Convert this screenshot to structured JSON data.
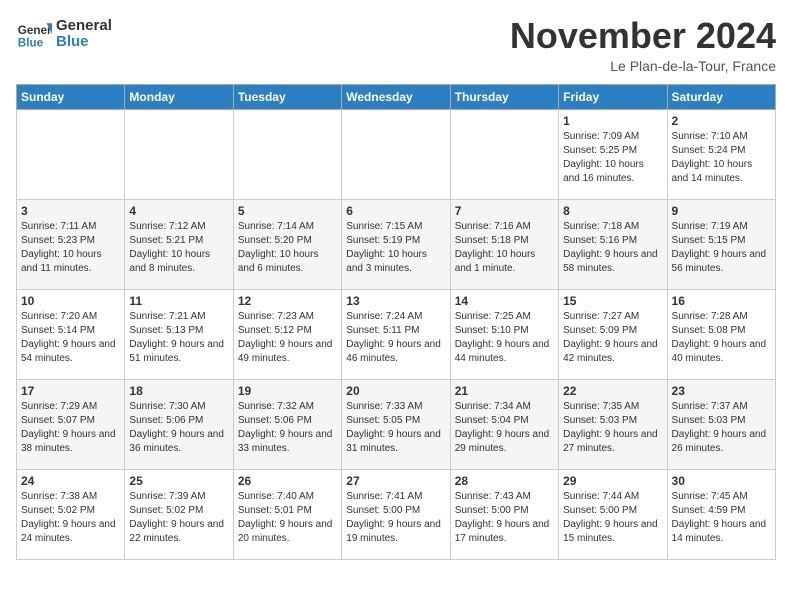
{
  "header": {
    "logo_line1": "General",
    "logo_line2": "Blue",
    "month": "November 2024",
    "location": "Le Plan-de-la-Tour, France"
  },
  "weekdays": [
    "Sunday",
    "Monday",
    "Tuesday",
    "Wednesday",
    "Thursday",
    "Friday",
    "Saturday"
  ],
  "weeks": [
    [
      {
        "day": "",
        "info": ""
      },
      {
        "day": "",
        "info": ""
      },
      {
        "day": "",
        "info": ""
      },
      {
        "day": "",
        "info": ""
      },
      {
        "day": "",
        "info": ""
      },
      {
        "day": "1",
        "info": "Sunrise: 7:09 AM\nSunset: 5:25 PM\nDaylight: 10 hours and 16 minutes."
      },
      {
        "day": "2",
        "info": "Sunrise: 7:10 AM\nSunset: 5:24 PM\nDaylight: 10 hours and 14 minutes."
      }
    ],
    [
      {
        "day": "3",
        "info": "Sunrise: 7:11 AM\nSunset: 5:23 PM\nDaylight: 10 hours and 11 minutes."
      },
      {
        "day": "4",
        "info": "Sunrise: 7:12 AM\nSunset: 5:21 PM\nDaylight: 10 hours and 8 minutes."
      },
      {
        "day": "5",
        "info": "Sunrise: 7:14 AM\nSunset: 5:20 PM\nDaylight: 10 hours and 6 minutes."
      },
      {
        "day": "6",
        "info": "Sunrise: 7:15 AM\nSunset: 5:19 PM\nDaylight: 10 hours and 3 minutes."
      },
      {
        "day": "7",
        "info": "Sunrise: 7:16 AM\nSunset: 5:18 PM\nDaylight: 10 hours and 1 minute."
      },
      {
        "day": "8",
        "info": "Sunrise: 7:18 AM\nSunset: 5:16 PM\nDaylight: 9 hours and 58 minutes."
      },
      {
        "day": "9",
        "info": "Sunrise: 7:19 AM\nSunset: 5:15 PM\nDaylight: 9 hours and 56 minutes."
      }
    ],
    [
      {
        "day": "10",
        "info": "Sunrise: 7:20 AM\nSunset: 5:14 PM\nDaylight: 9 hours and 54 minutes."
      },
      {
        "day": "11",
        "info": "Sunrise: 7:21 AM\nSunset: 5:13 PM\nDaylight: 9 hours and 51 minutes."
      },
      {
        "day": "12",
        "info": "Sunrise: 7:23 AM\nSunset: 5:12 PM\nDaylight: 9 hours and 49 minutes."
      },
      {
        "day": "13",
        "info": "Sunrise: 7:24 AM\nSunset: 5:11 PM\nDaylight: 9 hours and 46 minutes."
      },
      {
        "day": "14",
        "info": "Sunrise: 7:25 AM\nSunset: 5:10 PM\nDaylight: 9 hours and 44 minutes."
      },
      {
        "day": "15",
        "info": "Sunrise: 7:27 AM\nSunset: 5:09 PM\nDaylight: 9 hours and 42 minutes."
      },
      {
        "day": "16",
        "info": "Sunrise: 7:28 AM\nSunset: 5:08 PM\nDaylight: 9 hours and 40 minutes."
      }
    ],
    [
      {
        "day": "17",
        "info": "Sunrise: 7:29 AM\nSunset: 5:07 PM\nDaylight: 9 hours and 38 minutes."
      },
      {
        "day": "18",
        "info": "Sunrise: 7:30 AM\nSunset: 5:06 PM\nDaylight: 9 hours and 36 minutes."
      },
      {
        "day": "19",
        "info": "Sunrise: 7:32 AM\nSunset: 5:06 PM\nDaylight: 9 hours and 33 minutes."
      },
      {
        "day": "20",
        "info": "Sunrise: 7:33 AM\nSunset: 5:05 PM\nDaylight: 9 hours and 31 minutes."
      },
      {
        "day": "21",
        "info": "Sunrise: 7:34 AM\nSunset: 5:04 PM\nDaylight: 9 hours and 29 minutes."
      },
      {
        "day": "22",
        "info": "Sunrise: 7:35 AM\nSunset: 5:03 PM\nDaylight: 9 hours and 27 minutes."
      },
      {
        "day": "23",
        "info": "Sunrise: 7:37 AM\nSunset: 5:03 PM\nDaylight: 9 hours and 26 minutes."
      }
    ],
    [
      {
        "day": "24",
        "info": "Sunrise: 7:38 AM\nSunset: 5:02 PM\nDaylight: 9 hours and 24 minutes."
      },
      {
        "day": "25",
        "info": "Sunrise: 7:39 AM\nSunset: 5:02 PM\nDaylight: 9 hours and 22 minutes."
      },
      {
        "day": "26",
        "info": "Sunrise: 7:40 AM\nSunset: 5:01 PM\nDaylight: 9 hours and 20 minutes."
      },
      {
        "day": "27",
        "info": "Sunrise: 7:41 AM\nSunset: 5:00 PM\nDaylight: 9 hours and 19 minutes."
      },
      {
        "day": "28",
        "info": "Sunrise: 7:43 AM\nSunset: 5:00 PM\nDaylight: 9 hours and 17 minutes."
      },
      {
        "day": "29",
        "info": "Sunrise: 7:44 AM\nSunset: 5:00 PM\nDaylight: 9 hours and 15 minutes."
      },
      {
        "day": "30",
        "info": "Sunrise: 7:45 AM\nSunset: 4:59 PM\nDaylight: 9 hours and 14 minutes."
      }
    ]
  ]
}
